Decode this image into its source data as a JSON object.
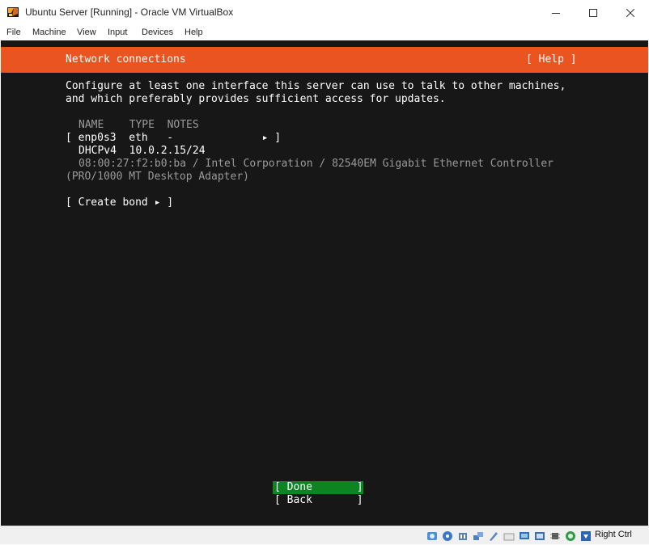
{
  "window": {
    "title": "Ubuntu Server [Running] - Oracle VM VirtualBox",
    "icons": {
      "minimize": "minimize-icon",
      "maximize": "maximize-icon",
      "close": "close-icon"
    }
  },
  "menubar": [
    "File",
    "Machine",
    "View",
    "Input",
    "Devices",
    "Help"
  ],
  "screen": {
    "header_title": "Network connections",
    "help_label": "[ Help ]",
    "intro_line1": "Configure at least one interface this server can use to talk to other machines,",
    "intro_line2": "and which preferably provides sufficient access for updates.",
    "table_header": "NAME    TYPE  NOTES",
    "iface_row": "[ enp0s3  eth   -              ▸ ]",
    "dhcp_row": "DHCPv4  10.0.2.15/24",
    "hw_line1": "08:00:27:f2:b0:ba / Intel Corporation / 82540EM Gigabit Ethernet Controller",
    "hw_line2": "(PRO/1000 MT Desktop Adapter)",
    "create_bond": "[ Create bond ▸ ]",
    "done_label": "[ Done       ]",
    "back_label": "[ Back       ]"
  },
  "statusbar": {
    "host_key": "Right Ctrl",
    "icons": [
      "hard-disk-icon",
      "optical-drive-icon",
      "audio-icon",
      "network-icon",
      "usb-icon",
      "shared-folders-icon",
      "display-icon",
      "video-capture-icon",
      "cpu-icon",
      "mouse-integration-icon",
      "host-key-arrow-icon"
    ]
  },
  "colors": {
    "accent": "#E95420",
    "done_button": "#0e8420",
    "screen_bg": "#171717"
  }
}
